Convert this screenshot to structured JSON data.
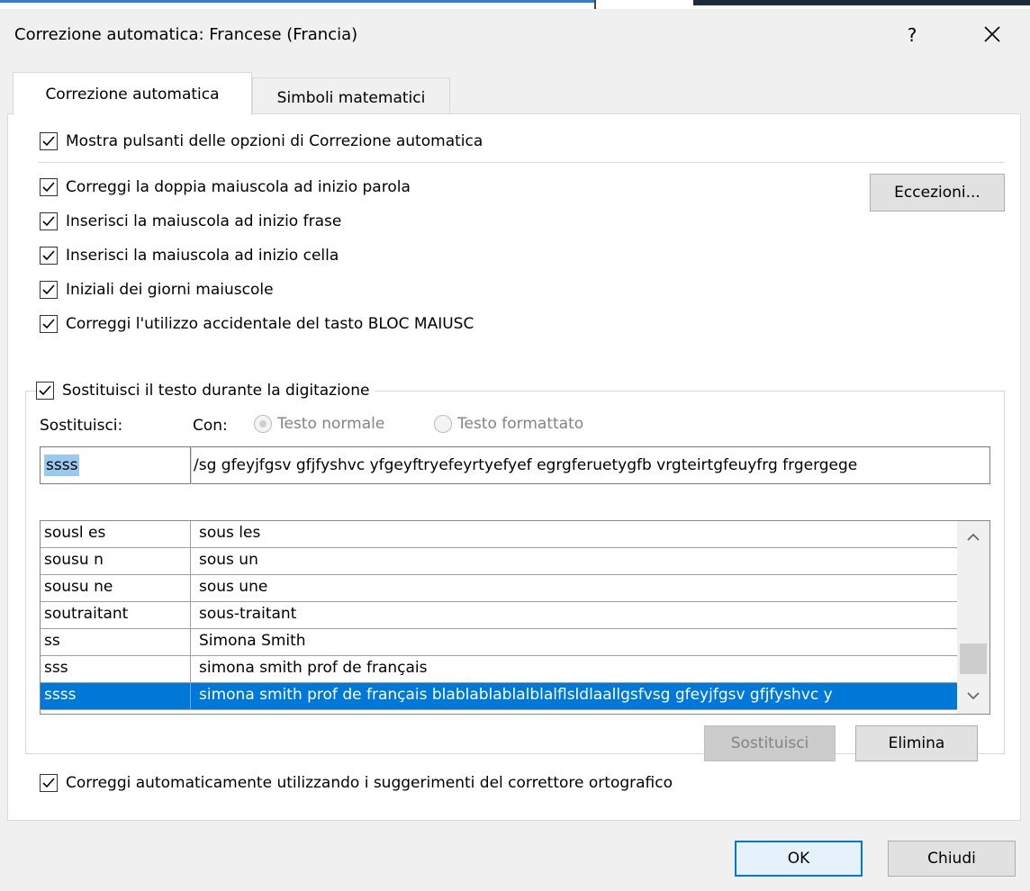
{
  "window": {
    "title": "Correzione automatica: Francese (Francia)",
    "help": "?"
  },
  "tabs": [
    {
      "label": "Correzione automatica",
      "active": true
    },
    {
      "label": "Simboli matematici",
      "active": false
    }
  ],
  "options": {
    "show_buttons": "Mostra pulsanti delle opzioni di Correzione automatica",
    "double_caps": "Correggi la doppia maiuscola ad inizio parola",
    "sentence_caps": "Inserisci la maiuscola ad inizio frase",
    "cell_caps": "Inserisci la maiuscola ad inizio cella",
    "day_names": "Iniziali dei giorni maiuscole",
    "caps_lock": "Correggi l'utilizzo accidentale del tasto BLOC MAIUSC"
  },
  "exceptions_label": "Eccezioni...",
  "replace_group": {
    "label": "Sostituisci il testo durante la digitazione",
    "replace_label": "Sostituisci:",
    "with_label": "Con:",
    "plain_text": "Testo normale",
    "formatted_text": "Testo formattato",
    "replace_value": "ssss",
    "with_value": "/sg gfeyjfgsv gfjfyshvc yfgeyftryefeyrtyefyef egrgferuetygfb vrgteirtgfeuyfrg frgergege",
    "entries": [
      {
        "key": "sousl es",
        "value": "sous les"
      },
      {
        "key": "sousu n",
        "value": "sous un"
      },
      {
        "key": "sousu ne",
        "value": "sous une"
      },
      {
        "key": "soutraitant",
        "value": "sous-traitant"
      },
      {
        "key": "ss",
        "value": "Simona Smith"
      },
      {
        "key": "sss",
        "value": "simona smith prof de français"
      },
      {
        "key": "ssss",
        "value": "simona smith prof de français blablablablalblalflsldlaallgsfvsg gfeyjfgsv gfjfyshvc y"
      }
    ],
    "replace_button": "Sostituisci",
    "delete_button": "Elimina"
  },
  "spellcheck_label": "Correggi automaticamente utilizzando i suggerimenti del correttore ortografico",
  "footer": {
    "ok": "OK",
    "close": "Chiudi"
  }
}
